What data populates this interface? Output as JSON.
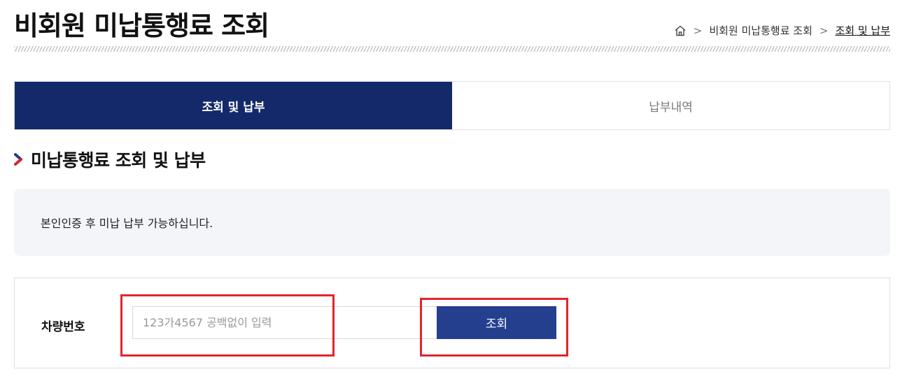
{
  "page": {
    "title": "비회원 미납통행료 조회"
  },
  "breadcrumb": {
    "home_icon": "home-icon",
    "items": [
      "비회원 미납통행료 조회",
      "조회 및 납부"
    ],
    "separator": ">"
  },
  "tabs": [
    {
      "label": "조회 및 납부",
      "active": true
    },
    {
      "label": "납부내역",
      "active": false
    }
  ],
  "section": {
    "title": "미납통행료 조회 및 납부",
    "bullet_icon": "chevron-right-icon"
  },
  "notice": {
    "text": "본인인증 후 미납 납부 가능하십니다."
  },
  "form": {
    "vehicle_label": "차량번호",
    "vehicle_placeholder": "123가4567 공백없이 입력",
    "vehicle_value": "",
    "search_button": "조회"
  },
  "colors": {
    "tab_active_bg": "#13296a",
    "button_bg": "#253f8f",
    "highlight": "#e0262d",
    "notice_bg": "#f3f5f8"
  }
}
